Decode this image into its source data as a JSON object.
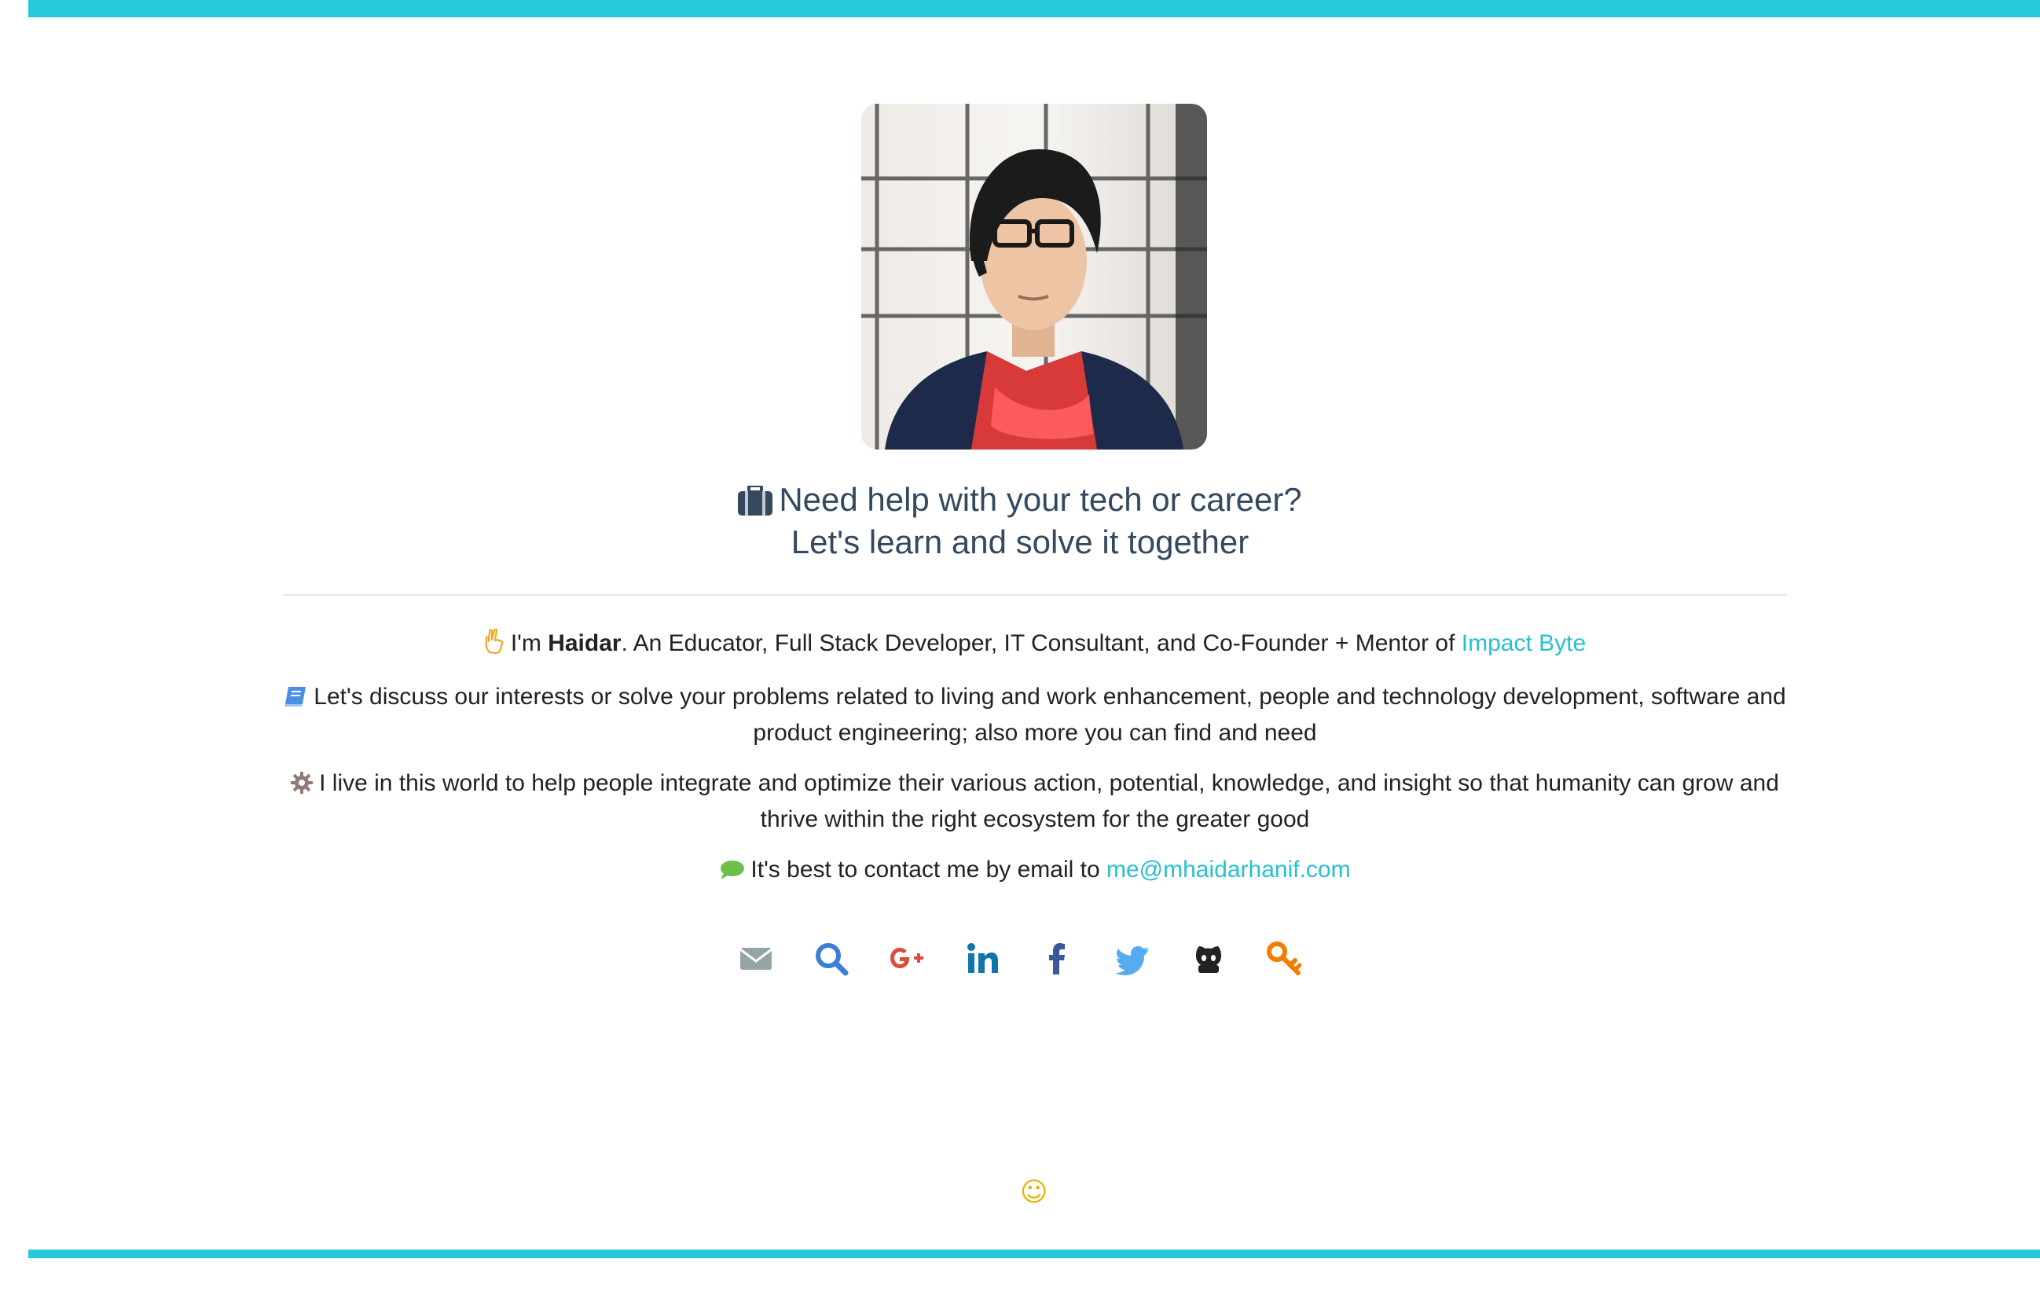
{
  "headline": {
    "line1": "Need help with your tech or career?",
    "line2": "Let's learn and solve it together"
  },
  "bio": {
    "intro_prefix": "I'm ",
    "name": "Haidar",
    "intro_suffix": ". An Educator, Full Stack Developer, IT Consultant, and Co-Founder + Mentor of ",
    "company_link": "Impact Byte",
    "discuss": "Let's discuss our interests or solve your problems related to living and work enhancement, people and technology development, software and product engineering; also more you can find and need",
    "mission": "I live in this world to help people integrate and optimize their various action, potential, knowledge, and insight so that humanity can grow and thrive within the right ecosystem for the greater good",
    "contact_prefix": "It's best to contact me by email to ",
    "email": "me@mhaidarhanif.com"
  },
  "socials": [
    {
      "icon": "envelope-icon",
      "color": "#95a5a6"
    },
    {
      "icon": "search-icon",
      "color": "#3b7dd8"
    },
    {
      "icon": "google-plus-icon",
      "color": "#dd4b39"
    },
    {
      "icon": "linkedin-icon",
      "color": "#0e76a8"
    },
    {
      "icon": "facebook-icon",
      "color": "#3b5998"
    },
    {
      "icon": "twitter-icon",
      "color": "#55acee"
    },
    {
      "icon": "github-icon",
      "color": "#222222"
    },
    {
      "icon": "key-icon",
      "color": "#f57c00"
    }
  ],
  "footer": {
    "smile": "☺"
  },
  "colors": {
    "accent": "#26c9d9",
    "heading": "#34495e",
    "link": "#26c0d2"
  }
}
